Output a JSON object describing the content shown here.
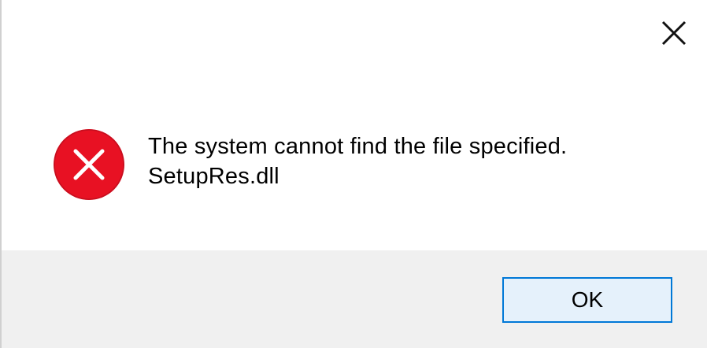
{
  "dialog": {
    "close_icon": "close-icon",
    "error_icon": "error-circle-x-icon",
    "message_line1": "The system cannot find the file specified.",
    "message_line2": "SetupRes.dll",
    "ok_label": "OK",
    "colors": {
      "error_red": "#e81123",
      "button_border": "#0078d7",
      "button_fill": "#e5f1fb",
      "footer_bg": "#f0f0f0"
    }
  }
}
